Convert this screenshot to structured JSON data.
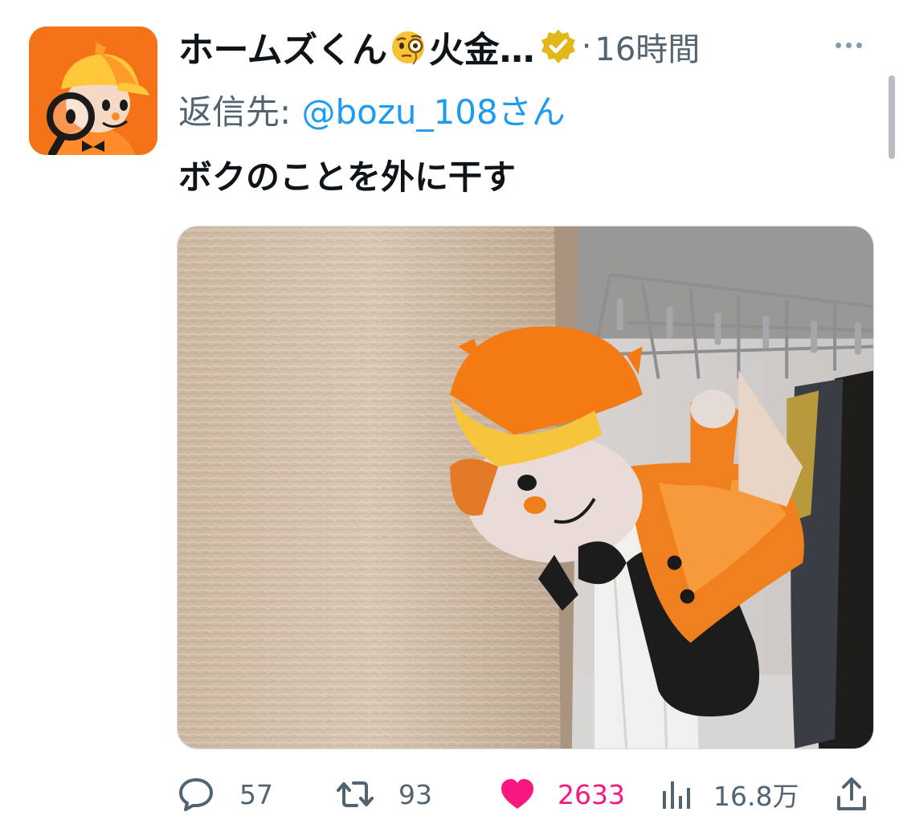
{
  "tweet": {
    "display_name": "ホームズくん",
    "name_suffix": "火金…",
    "dot": "·",
    "timestamp": "16時間",
    "reply_prefix": "返信先: ",
    "reply_handle": "@bozu_108さん",
    "text": "ボクのことを外に干す"
  },
  "actions": {
    "replies": "57",
    "retweets": "93",
    "likes": "2633",
    "views": "16.8万"
  },
  "icons": {
    "avatar": "mascot-avatar-icon",
    "emoji": "face-with-monocle-icon",
    "badge": "verified-badge-icon",
    "more": "more-options-icon",
    "reply": "reply-bubble-icon",
    "retweet": "retweet-icon",
    "like": "heart-icon",
    "views": "analytics-bars-icon",
    "share": "share-icon"
  },
  "colors": {
    "text_primary": "#0f1419",
    "text_secondary": "#536471",
    "link": "#1d9bf0",
    "like": "#f91880",
    "badge_gold": "#e2b719"
  }
}
